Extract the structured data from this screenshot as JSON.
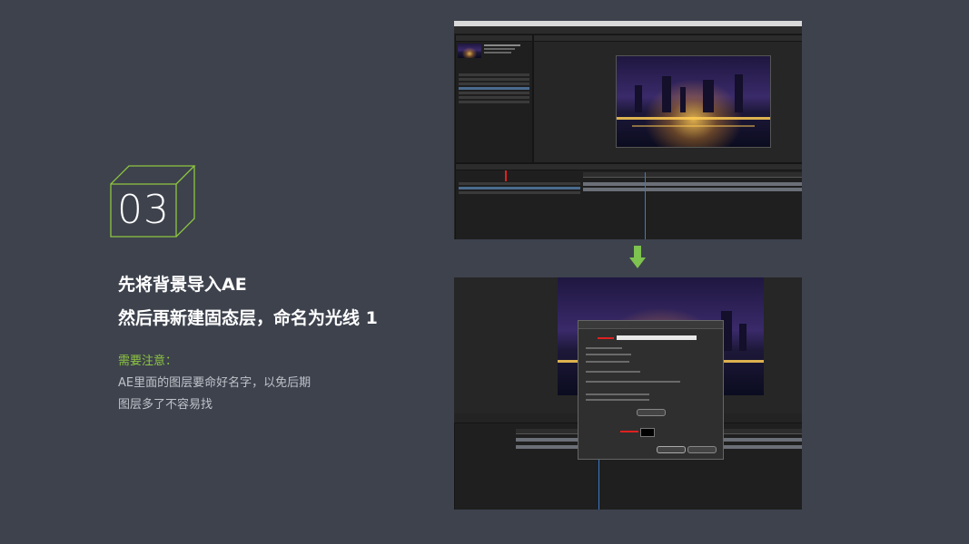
{
  "step": {
    "number": "03"
  },
  "title": {
    "line1": "先将背景导入AE",
    "line2": "然后再新建固态层，命名为光线 1"
  },
  "note": {
    "label": "需要注意：",
    "line1": "AE里面的图层要命好名字，以免后期",
    "line2": "图层多了不容易找"
  },
  "colors": {
    "background": "#3d424d",
    "accent_green": "#8ec63f",
    "arrow_green": "#7ec24f",
    "annotation_red": "#e02020"
  },
  "screenshots": [
    {
      "name": "after-effects-import-background",
      "arrow": "down-arrow-icon"
    },
    {
      "name": "after-effects-solid-settings-dialog"
    }
  ]
}
